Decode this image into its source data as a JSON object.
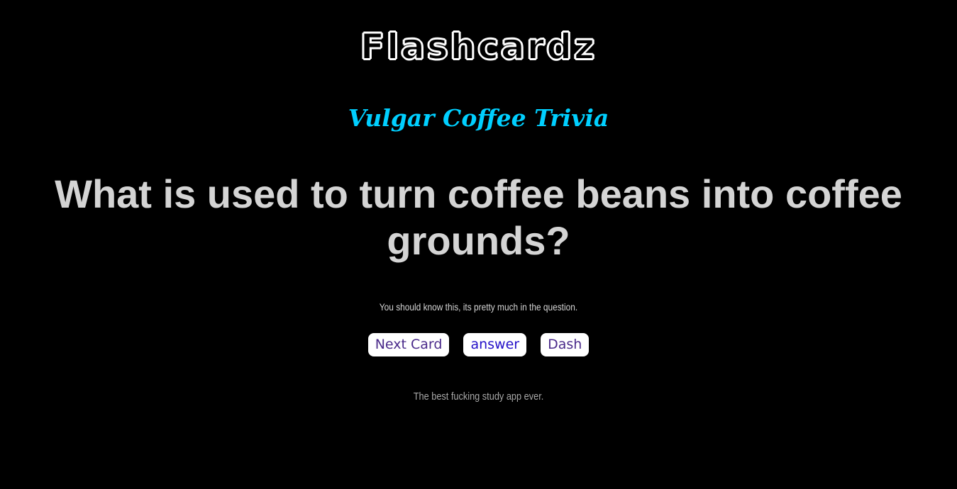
{
  "app": {
    "logo_text": "Flashcardz"
  },
  "deck": {
    "title": "Vulgar Coffee Trivia"
  },
  "card": {
    "question": "What is used to turn coffee beans into coffee grounds?",
    "hint": "You should know this, its pretty much in the question."
  },
  "buttons": {
    "next_label": "Next Card",
    "answer_label": "answer",
    "dash_label": "Dash"
  },
  "footer": {
    "tagline": "The best fucking study app ever."
  },
  "colors": {
    "background": "#000000",
    "deck_title": "#00cfff",
    "question_text": "#d4d4d4",
    "button_bg": "#ffffff",
    "button_text": "#4a2a8a",
    "answer_text": "#2410c8"
  }
}
